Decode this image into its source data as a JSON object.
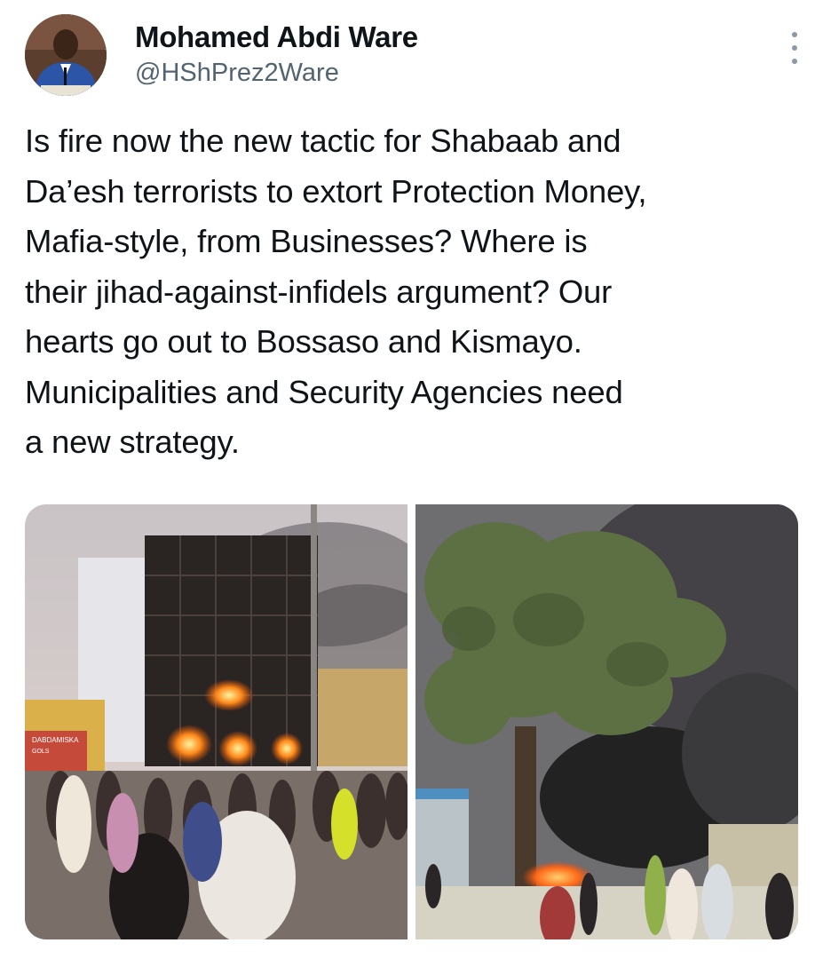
{
  "author": {
    "display_name": "Mohamed Abdi Ware",
    "handle": "@HShPrez2Ware",
    "avatar_icon": "profile-photo"
  },
  "tweet": {
    "text": "Is fire now the new tactic for Shabaab and\nDa’esh terrorists to extort Protection Money,\nMafia-style, from Businesses? Where is\ntheir jihad-against-infidels argument? Our\nhearts go out to Bossaso and Kismayo.\nMunicipalities and Security Agencies need\na new strategy."
  },
  "media": {
    "photo_left": {
      "sign_text": "DABDAMISKA",
      "sign_sub": "GOLS"
    }
  },
  "colors": {
    "text": "#0f1419",
    "secondary": "#536471",
    "fire": "#ff6a1a",
    "smoke": "#2d2d2d"
  }
}
